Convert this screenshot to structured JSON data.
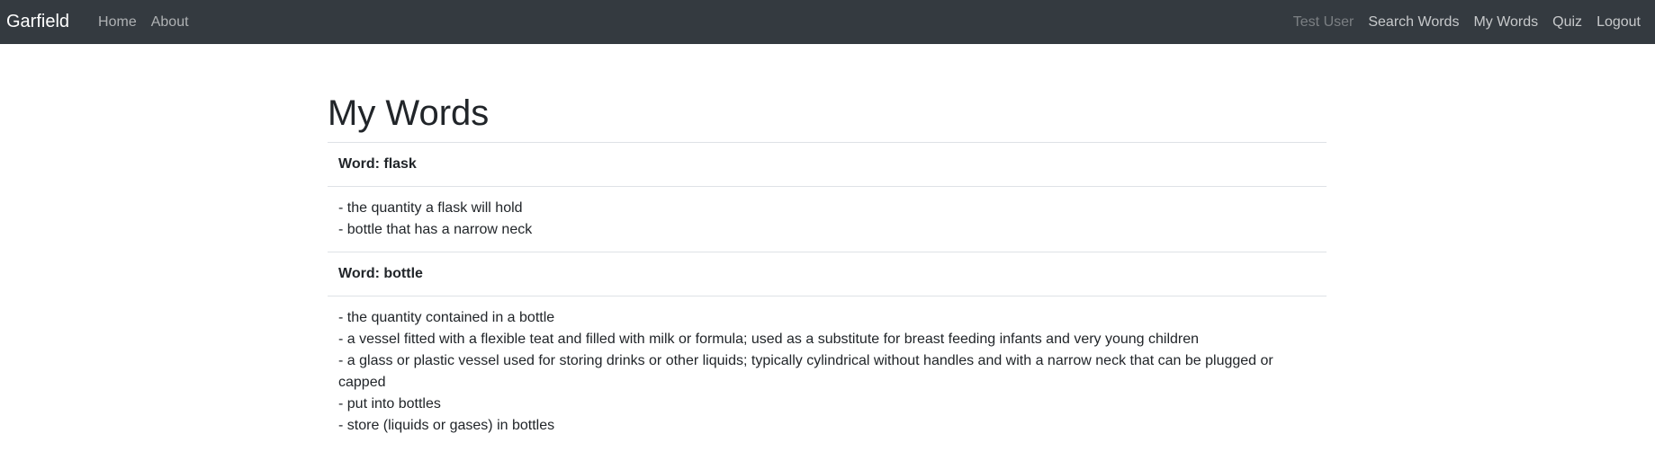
{
  "navbar": {
    "brand": "Garfield",
    "left_links": [
      {
        "label": "Home"
      },
      {
        "label": "About"
      }
    ],
    "right_links": [
      {
        "label": "Test User"
      },
      {
        "label": "Search Words"
      },
      {
        "label": "My Words"
      },
      {
        "label": "Quiz"
      },
      {
        "label": "Logout"
      }
    ],
    "colors": {
      "background": "#343a40"
    }
  },
  "main": {
    "title": "My Words",
    "words": [
      {
        "heading": "Word: flask",
        "definitions": [
          "- the quantity a flask will hold",
          "- bottle that has a narrow neck"
        ]
      },
      {
        "heading": "Word: bottle",
        "definitions": [
          "- the quantity contained in a bottle",
          "- a vessel fitted with a flexible teat and filled with milk or formula; used as a substitute for breast feeding infants and very young children",
          "- a glass or plastic vessel used for storing drinks or other liquids; typically cylindrical without handles and with a narrow neck that can be plugged or capped",
          "- put into bottles",
          "- store (liquids or gases) in bottles"
        ]
      }
    ]
  }
}
